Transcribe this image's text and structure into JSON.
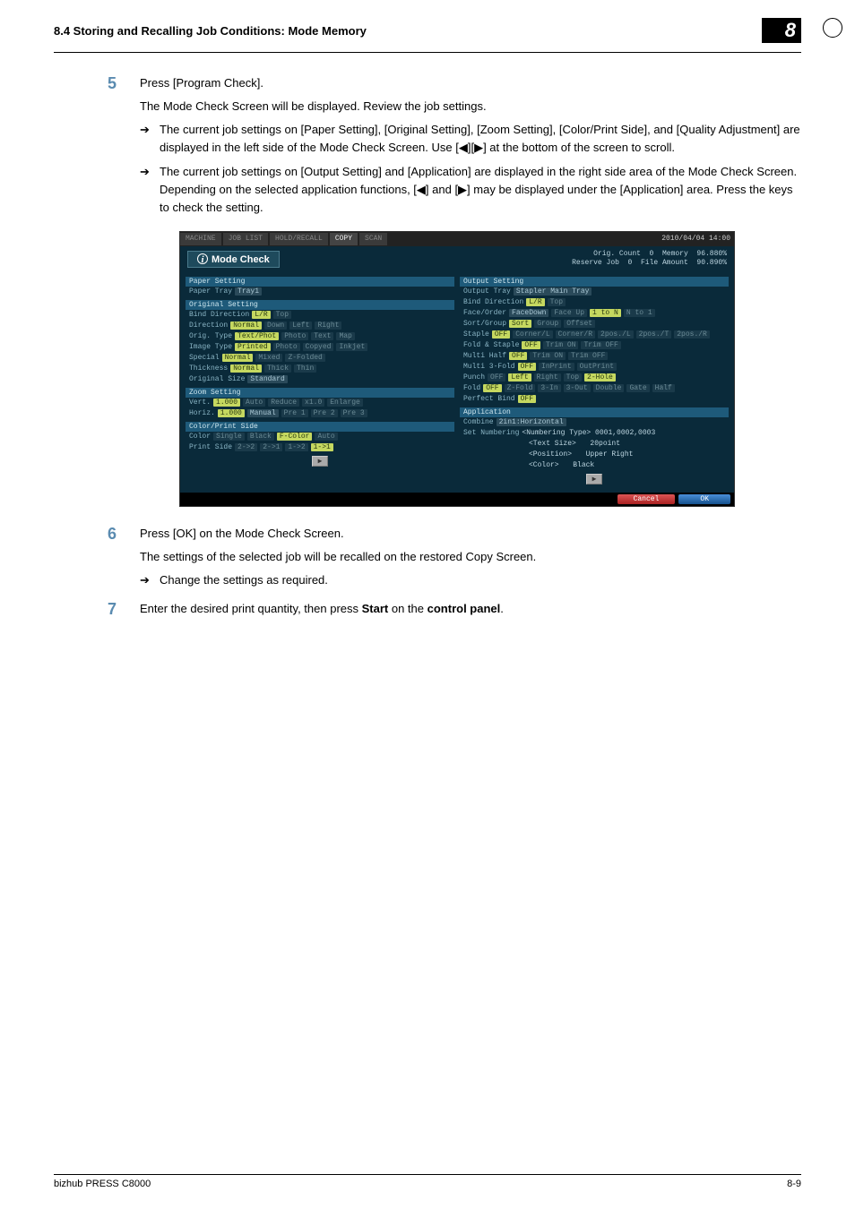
{
  "header": {
    "section": "8.4    Storing and Recalling Job Conditions: Mode Memory",
    "chapter": "8"
  },
  "steps": {
    "s5": {
      "num": "5",
      "line1": "Press [Program Check].",
      "line2": "The Mode Check Screen will be displayed. Review the job settings.",
      "bullet1": "The current job settings on [Paper Setting], [Original Setting], [Zoom Setting], [Color/Print Side], and [Quality Adjustment] are displayed in the left side of the Mode Check Screen. Use [◀][▶] at the bottom of the screen to scroll.",
      "bullet2": "The current job settings on [Output Setting] and [Application] are displayed in the right side area of the Mode Check Screen. Depending on the selected application functions, [◀] and [▶] may be displayed under the [Application] area. Press the keys to check the setting."
    },
    "s6": {
      "num": "6",
      "line1": "Press [OK] on the Mode Check Screen.",
      "line2": "The settings of the selected job will be recalled on the restored Copy Screen.",
      "bullet1": "Change the settings as required."
    },
    "s7": {
      "num": "7",
      "line1_a": "Enter the desired print quantity, then press ",
      "line1_b": "Start",
      "line1_c": " on the ",
      "line1_d": "control panel",
      "line1_e": "."
    }
  },
  "scr": {
    "tabs": {
      "machine": "MACHINE",
      "joblist": "JOB LIST",
      "recall": "HOLD/RECALL",
      "copy": "COPY",
      "scan": "SCAN"
    },
    "datetime": "2010/04/04  14:00",
    "title": "Mode Check",
    "head_r": {
      "l1a": "Orig. Count",
      "l1b": "0",
      "l1c": "Memory",
      "l1d": "96.880%",
      "l2a": "Reserve Job",
      "l2b": "0",
      "l2c": "File Amount",
      "l2d": "90.890%"
    },
    "left": {
      "h1": "Paper Setting",
      "paper_tray_l": "Paper Tray",
      "paper_tray_v": "Tray1",
      "h2": "Original Setting",
      "bind_l": "Bind Direction",
      "bind_v1": "L/R",
      "bind_v2": "Top",
      "dir_l": "Direction",
      "dir_v": "Normal",
      "dir_2": "Down",
      "dir_3": "Left",
      "dir_4": "Right",
      "ot_l": "Orig. Type",
      "ot_v": "Text/Phot",
      "ot_2": "Photo",
      "ot_3": "Text",
      "ot_4": "Map",
      "it_l": "Image Type",
      "it_v": "Printed",
      "it_2": "Photo",
      "it_3": "Copyed",
      "it_4": "Inkjet",
      "sp_l": "Special",
      "sp_v": "Normal",
      "sp_2": "Mixed",
      "sp_3": "Z-Folded",
      "th_l": "Thickness",
      "th_v": "Normal",
      "th_2": "Thick",
      "th_3": "Thin",
      "os_l": "Original Size",
      "os_v": "Standard",
      "h3": "Zoom Setting",
      "vert_l": "Vert.",
      "vert_v": "1.000",
      "vert_2": "Auto",
      "vert_3": "Reduce",
      "vert_4": "x1.0",
      "vert_5": "Enlarge",
      "horiz_l": "Horiz.",
      "horiz_v": "1.000",
      "horiz_2": "Manual",
      "horiz_3": "Pre 1",
      "horiz_4": "Pre 2",
      "horiz_5": "Pre 3",
      "h4": "Color/Print Side",
      "col_l": "Color",
      "col_2": "Single",
      "col_3": "Black",
      "col_v": "F-Color",
      "col_4": "Auto",
      "ps_l": "Print Side",
      "ps_2": "2->2",
      "ps_3": "2->1",
      "ps_4": "1->2",
      "ps_v": "1->1"
    },
    "right": {
      "h1": "Output Setting",
      "otray_l": "Output Tray",
      "otray_v": "Stapler Main Tray",
      "bd_l": "Bind Direction",
      "bd_v": "L/R",
      "bd_2": "Top",
      "fo_l": "Face/Order",
      "fo_v": "FaceDown",
      "fo_2": "Face Up",
      "fo_3": "1 to N",
      "fo_4": "N to 1",
      "sg_l": "Sort/Group",
      "sg_v": "Sort",
      "sg_2": "Group",
      "sg_3": "Offset",
      "st_l": "Staple",
      "st_v": "OFF",
      "st_2": "Corner/L",
      "st_3": "Corner/R",
      "st_4": "2pos./L",
      "st_5": "2pos./T",
      "st_6": "2pos./R",
      "fs_l": "Fold & Staple",
      "fs_v": "OFF",
      "fs_2": "Trim ON",
      "fs_3": "Trim OFF",
      "mh_l": "Multi Half",
      "mh_v": "OFF",
      "mh_2": "Trim ON",
      "mh_3": "Trim OFF",
      "m3_l": "Multi 3-Fold",
      "m3_v": "OFF",
      "m3_2": "InPrint",
      "m3_3": "OutPrint",
      "pu_l": "Punch",
      "pu_v": "OFF",
      "pu_2": "Left",
      "pu_3": "Right",
      "pu_4": "Top",
      "pu_5": "2-Hole",
      "fd_l": "Fold",
      "fd_v": "OFF",
      "fd_2": "Z-Fold",
      "fd_3": "3-In",
      "fd_4": "3-Out",
      "fd_5": "Double",
      "fd_6": "Gate",
      "fd_7": "Half",
      "pb_l": "Perfect Bind",
      "pb_v": "OFF",
      "h2": "Application",
      "cb_l": "Combine",
      "cb_v": "2in1:Horizontal",
      "sn_l": "Set Numbering",
      "sn_1": "<Numbering Type> 0001,0002,0003",
      "sn_2a": "<Text Size>",
      "sn_2b": "20point",
      "sn_3a": "<Position>",
      "sn_3b": "Upper Right",
      "sn_4a": "<Color>",
      "sn_4b": "Black"
    },
    "nav": "▶",
    "cancel": "Cancel",
    "ok": "OK"
  },
  "footer": {
    "left": "bizhub PRESS C8000",
    "right": "8-9"
  }
}
